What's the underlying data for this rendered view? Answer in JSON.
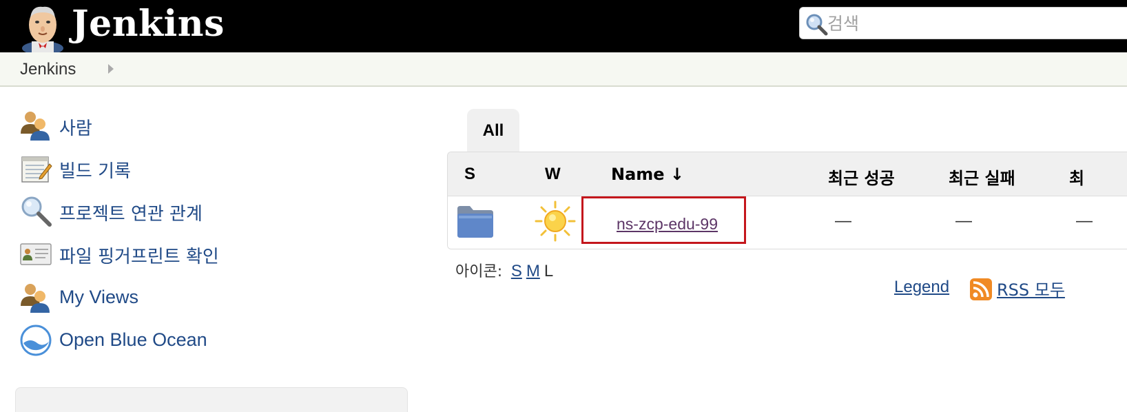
{
  "header": {
    "brand": "Jenkins",
    "search_placeholder": "검색"
  },
  "breadcrumb": {
    "items": [
      "Jenkins"
    ]
  },
  "sidebar": {
    "items": [
      {
        "label": "사람",
        "icon": "people-icon"
      },
      {
        "label": "빌드 기록",
        "icon": "notepad-icon"
      },
      {
        "label": "프로젝트 연관 관계",
        "icon": "magnifier-icon"
      },
      {
        "label": "파일 핑거프린트 확인",
        "icon": "fingerprint-card-icon"
      },
      {
        "label": "My Views",
        "icon": "people-icon"
      },
      {
        "label": "Open Blue Ocean",
        "icon": "blue-ocean-icon"
      }
    ]
  },
  "tabs": [
    {
      "label": "All",
      "active": true
    }
  ],
  "table": {
    "headers": {
      "status": "S",
      "weather": "W",
      "name": "Name ↓",
      "last_success": "최근 성공",
      "last_failure": "최근 실패",
      "last_duration": "최"
    },
    "rows": [
      {
        "status_icon": "folder-icon",
        "weather_icon": "sun-icon",
        "name": "ns-zcp-edu-99",
        "last_success": "—",
        "last_failure": "—",
        "last_duration": "—"
      }
    ]
  },
  "icon_size": {
    "label": "아이콘:",
    "options": [
      "S",
      "M",
      "L"
    ],
    "current": "L"
  },
  "footer_links": {
    "legend": "Legend",
    "rss_all": "RSS 모두"
  },
  "colors": {
    "header_bg": "#000000",
    "link": "#204a87",
    "visited_link": "#5c3566",
    "highlight_border": "#c4161c"
  }
}
